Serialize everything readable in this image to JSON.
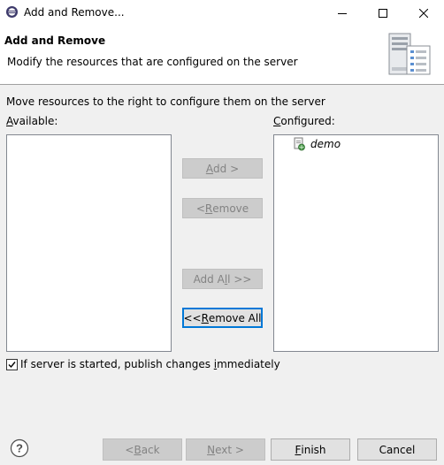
{
  "window": {
    "title": "Add and Remove...",
    "icons": [
      "eclipse-app-icon",
      "minimize-icon",
      "maximize-icon",
      "close-icon"
    ]
  },
  "banner": {
    "title": "Add and Remove",
    "description": "Modify the resources that are configured on the server",
    "graphic": "server-configuration-icon"
  },
  "instruction": "Move resources to the right to configure them on the server",
  "available": {
    "label_mnemonic": "A",
    "label_rest": "vailable:",
    "items": []
  },
  "configured": {
    "label_mnemonic": "C",
    "label_rest": "onfigured:",
    "items": [
      {
        "label": "demo",
        "icon": "web-module-icon"
      }
    ]
  },
  "buttons": {
    "add": {
      "pre": "",
      "mn": "A",
      "post": "dd >",
      "enabled": false
    },
    "remove": {
      "pre": "< ",
      "mn": "R",
      "post": "emove",
      "enabled": false
    },
    "add_all": {
      "pre": "Add A",
      "mn": "l",
      "post": "l >>",
      "enabled": false
    },
    "remove_all": {
      "pre": "<< ",
      "mn": "R",
      "post": "emove All",
      "enabled": true
    }
  },
  "publish_option": {
    "checked": true,
    "pre": "If server is started, publish changes ",
    "mn": "i",
    "post": "mmediately"
  },
  "footer": {
    "help_icon": "help-icon",
    "back": {
      "pre": "< ",
      "mn": "B",
      "post": "ack",
      "enabled": false
    },
    "next": {
      "pre": "",
      "mn": "N",
      "post": "ext >",
      "enabled": false
    },
    "finish": {
      "pre": "",
      "mn": "F",
      "post": "inish",
      "enabled": true
    },
    "cancel": {
      "label": "Cancel",
      "enabled": true
    }
  },
  "colors": {
    "focus_border": "#0078d7",
    "disabled_text": "#838383",
    "list_border": "#828790"
  }
}
